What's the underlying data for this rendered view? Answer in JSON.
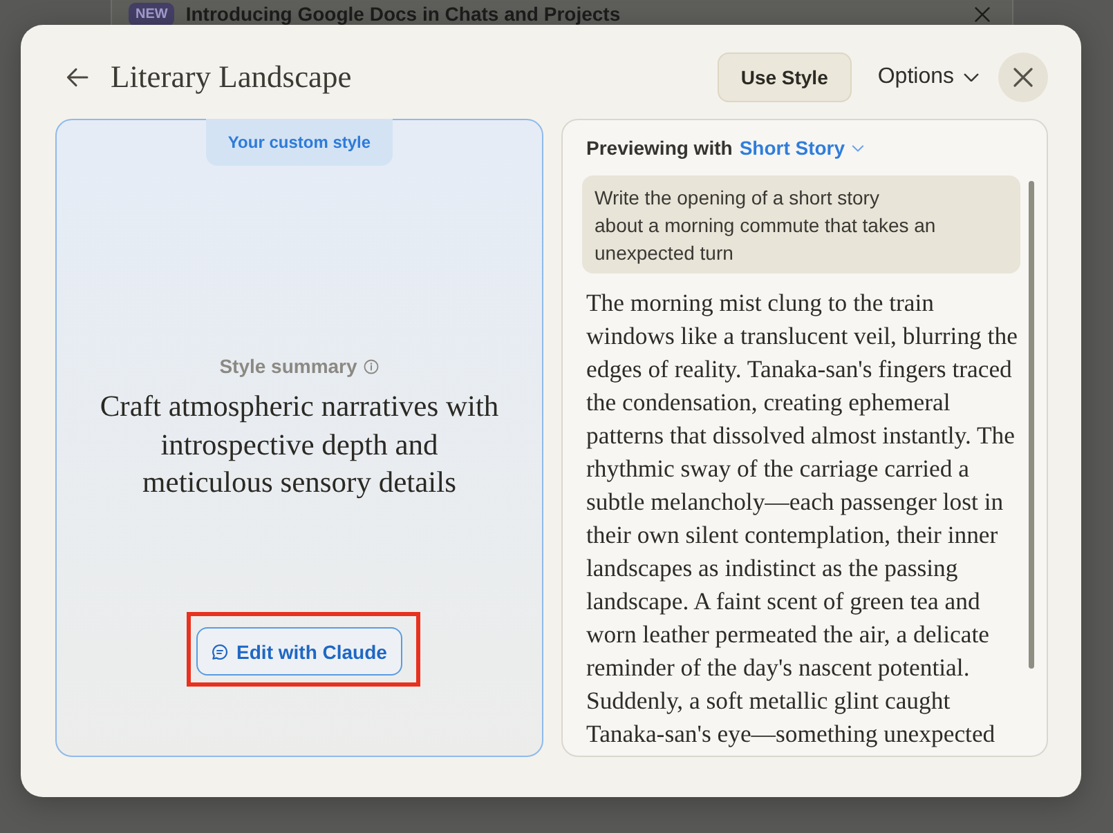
{
  "banner": {
    "badge": "NEW",
    "text": "Introducing Google Docs in Chats and Projects"
  },
  "dialog": {
    "title": "Literary Landscape",
    "use_style_button": "Use Style",
    "options_menu": "Options"
  },
  "style_card": {
    "tab": "Your custom style",
    "summary_label": "Style summary",
    "summary": "Craft atmospheric narratives with introspective depth and meticulous sensory details",
    "edit_button": "Edit with Claude",
    "highlighted": true
  },
  "preview": {
    "label": "Previewing with",
    "example": "Short Story",
    "prompt": "Write the opening of a short story\nabout a morning commute that takes an unexpected turn",
    "response": "The morning mist clung to the train windows like a translucent veil, blurring the edges of reality. Tanaka-san's fingers traced the condensation, creating ephemeral patterns that dissolved almost instantly. The rhythmic sway of the carriage carried a subtle melancholy—each passenger lost in their own silent contemplation, their inner landscapes as indistinct as the passing landscape. A faint scent of green tea and worn leather permeated the air, a delicate reminder of the day's nascent potential. Suddenly, a soft metallic glint caught Tanaka-san's eye—something unexpected"
  }
}
